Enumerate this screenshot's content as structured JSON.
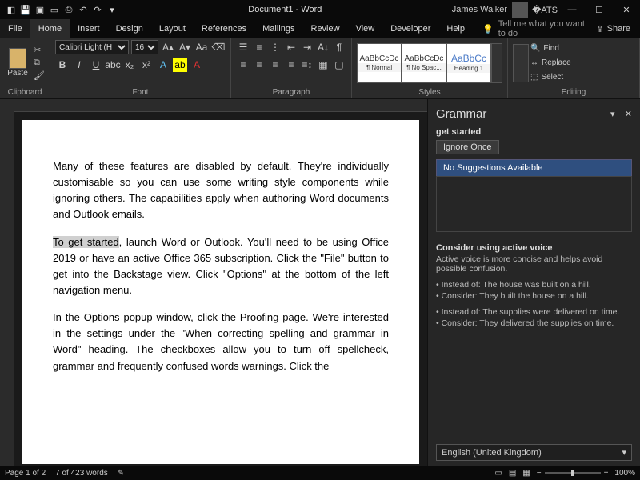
{
  "titlebar": {
    "doc_title": "Document1 - Word",
    "user_name": "James Walker"
  },
  "menubar": {
    "tabs": [
      "File",
      "Home",
      "Insert",
      "Design",
      "Layout",
      "References",
      "Mailings",
      "Review",
      "View",
      "Developer",
      "Help"
    ],
    "active_index": 1,
    "tellme_placeholder": "Tell me what you want to do",
    "share_label": "Share"
  },
  "ribbon": {
    "clipboard": {
      "label": "Clipboard",
      "paste": "Paste"
    },
    "font": {
      "label": "Font",
      "name": "Calibri Light (H",
      "size": "16",
      "buttons": [
        "B",
        "I",
        "U",
        "abc",
        "x₂",
        "x²"
      ]
    },
    "paragraph": {
      "label": "Paragraph"
    },
    "styles": {
      "label": "Styles",
      "items": [
        {
          "preview": "AaBbCcDc",
          "name": "¶ Normal"
        },
        {
          "preview": "AaBbCcDc",
          "name": "¶ No Spac..."
        },
        {
          "preview": "AaBbCc",
          "name": "Heading 1"
        }
      ]
    },
    "editing": {
      "label": "Editing",
      "find": "Find",
      "replace": "Replace",
      "select": "Select"
    }
  },
  "document": {
    "para1": "Many of these features are disabled by default. They're individually customisable so you can use some writing style components while ignoring others. The capabilities apply when authoring Word documents and Outlook emails.",
    "para2_lead": "To get started",
    "para2_rest": ", launch Word or Outlook. You'll need to be using Office 2019 or have an active Office 365 subscription. Click the \"File\" button to get into the Backstage view. Click \"Options\" at the bottom of the left navigation menu.",
    "para3": "In the Options popup window, click the Proofing page. We're interested in the settings under the \"When correcting spelling and grammar in Word\" heading. The checkboxes allow you to turn off spellcheck, grammar and frequently confused words warnings. Click the"
  },
  "pane": {
    "title": "Grammar",
    "issue_text": "get started",
    "ignore_label": "Ignore Once",
    "no_suggestions": "No Suggestions Available",
    "tip_title": "Consider using active voice",
    "tip_body": "Active voice is more concise and helps avoid possible confusion.",
    "ex1a": "• Instead of: The house was built on a hill.",
    "ex1b": "• Consider: They built the house on a hill.",
    "ex2a": "• Instead of: The supplies were delivered on time.",
    "ex2b": "• Consider: They delivered the supplies on time.",
    "language": "English (United Kingdom)"
  },
  "statusbar": {
    "page": "Page 1 of 2",
    "words": "7 of 423 words",
    "zoom": "100%"
  }
}
